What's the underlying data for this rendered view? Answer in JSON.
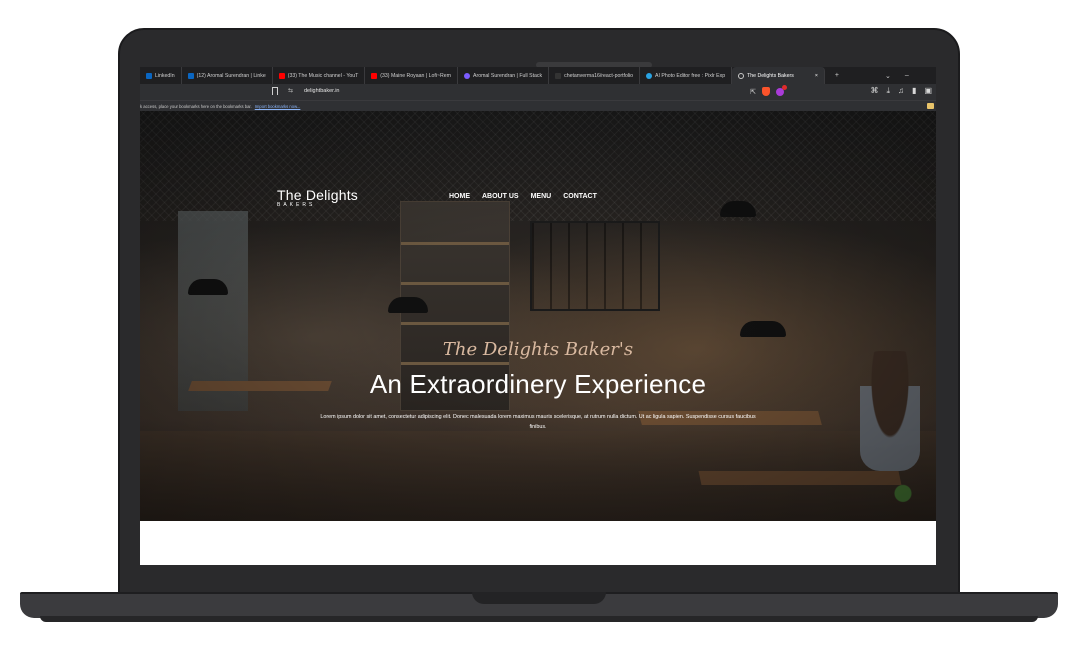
{
  "browser": {
    "tabs": [
      {
        "label": "LinkedIn",
        "color": "#0a66c2"
      },
      {
        "label": "(12) Aromal Surendran | Linke",
        "color": "#0a66c2"
      },
      {
        "label": "(33) The Music channel - YouT",
        "color": "#ff0000"
      },
      {
        "label": "(33) Maine Royaan | Lofi~Rem",
        "color": "#ff0000"
      },
      {
        "label": "Aromal Surendran | Full Stack",
        "color": "#7b5cff"
      },
      {
        "label": "chetanverma16/react-portfolio",
        "color": "#333333"
      },
      {
        "label": "AI Photo Editor free : Pixlr Exp",
        "color": "#29a3e3"
      },
      {
        "label": "The Delights Bakers",
        "color": "#c9c9c9"
      }
    ],
    "tab_close": "×",
    "new_tab": "+",
    "tab_menu": "⌄",
    "minimize": "–",
    "url": "delightbaker.in",
    "bookmarks_text": "k access, place your bookmarks here on the bookmarks bar.",
    "bookmarks_link": "Import bookmarks now..."
  },
  "site": {
    "brand_title": "The Delights",
    "brand_sub": "BAKERS",
    "nav": [
      "HOME",
      "ABOUT US",
      "MENU",
      "CONTACT"
    ],
    "script_title": "The Delights Baker's",
    "headline": "An Extraordinery Experience",
    "paragraph": "Lorem ipsum dolor sit amet, consectetur adipiscing elit. Donec malesuada lorem maximus mauris scelerisque, at rutrum nulla dictum. Ut ac ligula sapien. Suspendisse cursus faucibus finibus.",
    "scroll_indicator": "0"
  }
}
